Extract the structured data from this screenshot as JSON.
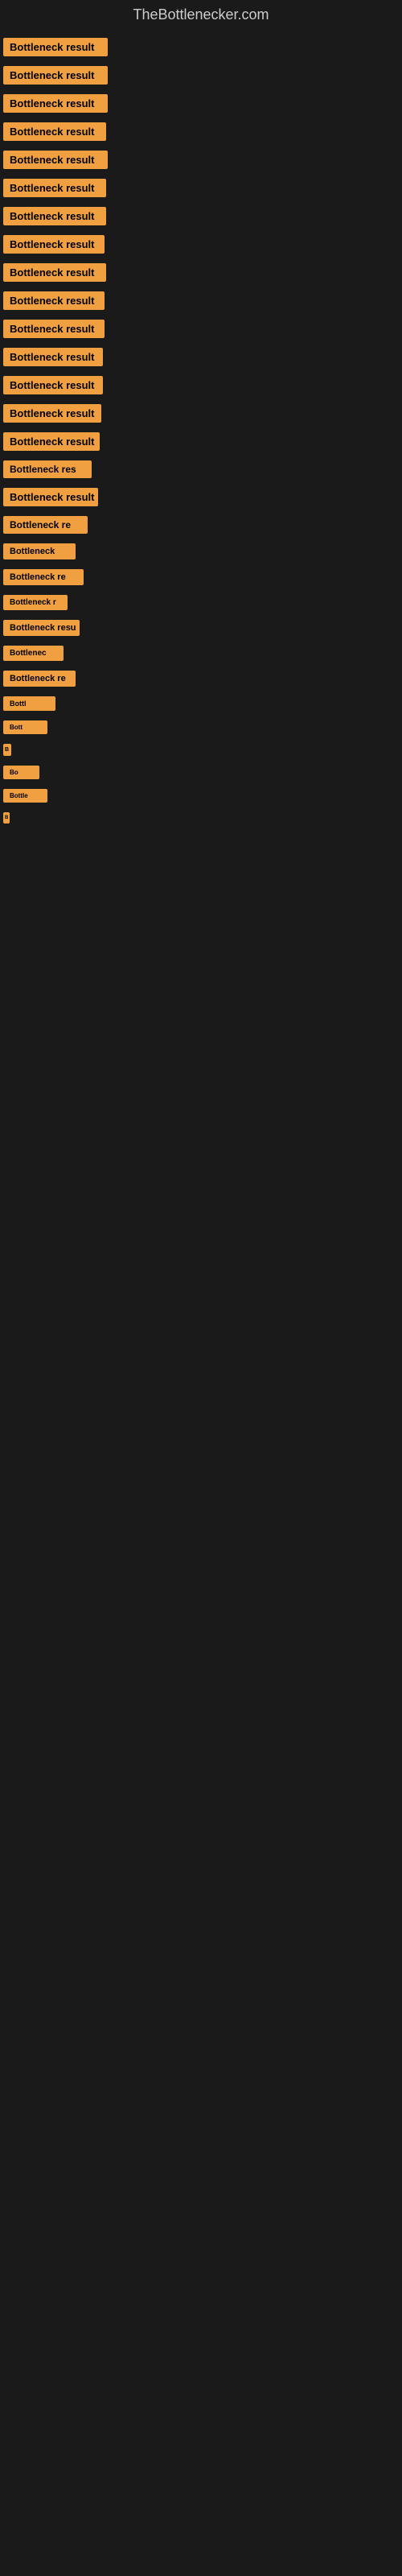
{
  "site": {
    "title": "TheBottlenecker.com"
  },
  "items": [
    {
      "label": "Bottleneck result"
    },
    {
      "label": "Bottleneck result"
    },
    {
      "label": "Bottleneck result"
    },
    {
      "label": "Bottleneck result"
    },
    {
      "label": "Bottleneck result"
    },
    {
      "label": "Bottleneck result"
    },
    {
      "label": "Bottleneck result"
    },
    {
      "label": "Bottleneck result"
    },
    {
      "label": "Bottleneck result"
    },
    {
      "label": "Bottleneck result"
    },
    {
      "label": "Bottleneck result"
    },
    {
      "label": "Bottleneck result"
    },
    {
      "label": "Bottleneck result"
    },
    {
      "label": "Bottleneck result"
    },
    {
      "label": "Bottleneck result"
    },
    {
      "label": "Bottleneck res"
    },
    {
      "label": "Bottleneck result"
    },
    {
      "label": "Bottleneck re"
    },
    {
      "label": "Bottleneck"
    },
    {
      "label": "Bottleneck re"
    },
    {
      "label": "Bottleneck r"
    },
    {
      "label": "Bottleneck resu"
    },
    {
      "label": "Bottlenec"
    },
    {
      "label": "Bottleneck re"
    },
    {
      "label": "Bottl"
    },
    {
      "label": "Bott"
    },
    {
      "label": "B"
    },
    {
      "label": "Bo"
    },
    {
      "label": "Bottle"
    },
    {
      "label": "B"
    }
  ]
}
